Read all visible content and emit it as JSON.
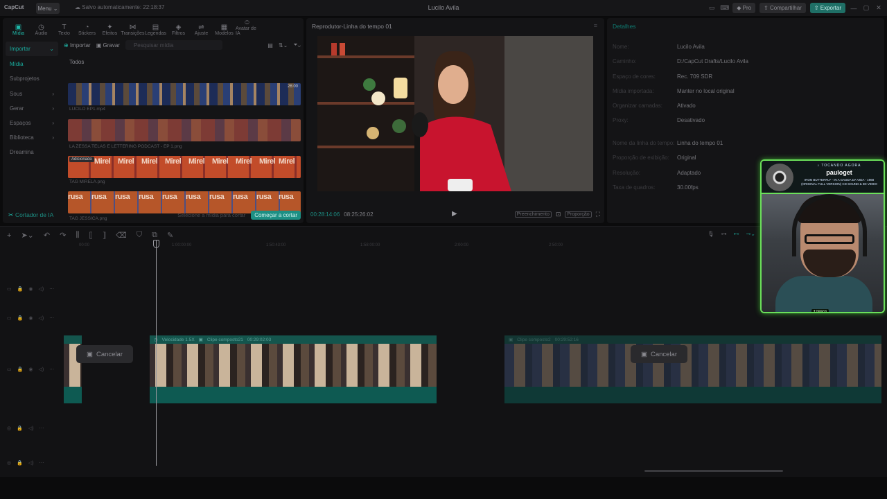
{
  "titlebar": {
    "logo": "CapCut",
    "menu": "Menu",
    "autosave": "Salvo automaticamente: 22:18:37",
    "title": "Lucilo Avila",
    "pro": "Pro",
    "share": "Compartilhar",
    "export": "Exportar"
  },
  "toolbar": [
    {
      "label": "Mídia",
      "icon": "▣"
    },
    {
      "label": "Áudio",
      "icon": "◷"
    },
    {
      "label": "Texto",
      "icon": "T"
    },
    {
      "label": "Stickers",
      "icon": "◔"
    },
    {
      "label": "Efeitos",
      "icon": "✦"
    },
    {
      "label": "Transições",
      "icon": "⋈"
    },
    {
      "label": "Legendas",
      "icon": "▤"
    },
    {
      "label": "Filtros",
      "icon": "◈"
    },
    {
      "label": "Ajuste",
      "icon": "⇌"
    },
    {
      "label": "Modelos",
      "icon": "▦"
    },
    {
      "label": "Avatar de IA",
      "icon": "☺"
    }
  ],
  "nav": [
    {
      "label": "Importar",
      "arrow": "⌄"
    },
    {
      "label": "Mídia",
      "arrow": ""
    },
    {
      "label": "Subprojetos",
      "arrow": ""
    },
    {
      "label": "Sous",
      "arrow": "›"
    },
    {
      "label": "Gerar",
      "arrow": "›"
    },
    {
      "label": "Espaços",
      "arrow": "›"
    },
    {
      "label": "Biblioteca",
      "arrow": "›"
    },
    {
      "label": "Dreamina",
      "arrow": ""
    }
  ],
  "media": {
    "import": "Importar",
    "record": "Gravar",
    "search_placeholder": "Pesquisar mídia",
    "section": "Todos",
    "items": [
      {
        "caption": "LUCILO EP1.mp4",
        "duration": "26:00",
        "tag": ""
      },
      {
        "caption": "LA ZESSA TELAS E LETTERING PODCAST - EP 1.png",
        "duration": "",
        "tag": ""
      },
      {
        "caption": "TAG MIRELA.png",
        "duration": "",
        "tag": "Adicionado"
      },
      {
        "caption": "TAG JESSICA.png",
        "duration": "",
        "tag": ""
      }
    ],
    "word3": "Mirel",
    "word4": "rusa",
    "cutter": "Cortador de IA",
    "cutter_hint": "Selecione a mídia para cortar",
    "cutter_btn": "Começar a cortar"
  },
  "player": {
    "title": "Reprodutor-Linha do tempo 01",
    "current": "00:28:14:06",
    "total": "08:25:26:02",
    "fill": "Preenchimento",
    "ratio": "Proporção"
  },
  "details": {
    "title": "Detalhes",
    "rows": [
      {
        "k": "Nome:",
        "v": "Lucilo Avila"
      },
      {
        "k": "Caminho:",
        "v": "D:/CapCut Drafts/Lucilo Avila"
      },
      {
        "k": "Espaço de cores:",
        "v": "Rec. 709 SDR"
      },
      {
        "k": "Mídia importada:",
        "v": "Manter no local original"
      },
      {
        "k": "Organizar camadas:",
        "v": "Ativado"
      },
      {
        "k": "Proxy:",
        "v": "Desativado"
      },
      {
        "k": "Nome da linha do tempo:",
        "v": "Linha do tempo 01"
      },
      {
        "k": "Proporção de exibição:",
        "v": "Original"
      },
      {
        "k": "Resolução:",
        "v": "Adaptado"
      },
      {
        "k": "Taxa de quadros:",
        "v": "30.00fps"
      }
    ]
  },
  "timeline": {
    "ruler": [
      "00:00",
      "1:00:00:00",
      "1:50:43:00",
      "1:58:00:00",
      "2:00:00",
      "2:50:00"
    ],
    "clip1_speed": "Velocidade 1.5X",
    "clip1_name": "Clipe composto21",
    "clip1_time": "00:29:02:03",
    "clip2_name": "Clipe composto2",
    "clip2_time": "00:29:52:16",
    "cancel": "Cancelar"
  },
  "overlay": {
    "label": "♪ TOCANDO AGORA",
    "user": "pauloget",
    "song": "IRON BUTTERFLY - IN A GADDA DA VIDA - 1968 (ORIGINAL FULL VERSION) CD SOUND & 3D VIDEO",
    "badge": "● NEBAX"
  }
}
